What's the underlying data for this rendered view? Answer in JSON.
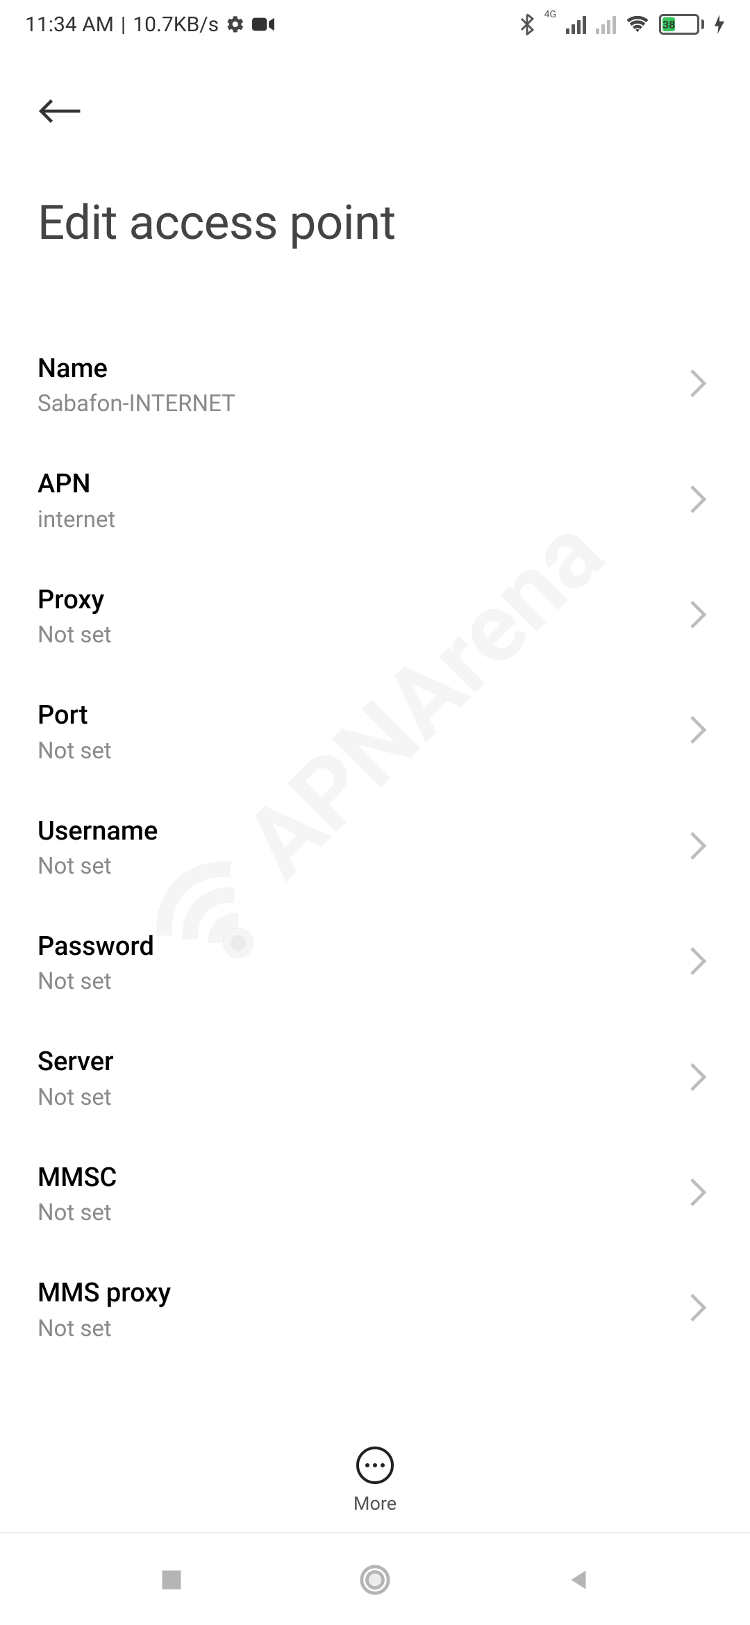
{
  "status": {
    "time": "11:34 AM",
    "speed": "10.7KB/s",
    "battery": "38"
  },
  "header": {
    "title": "Edit access point"
  },
  "settings": [
    {
      "label": "Name",
      "value": "Sabafon-INTERNET"
    },
    {
      "label": "APN",
      "value": "internet"
    },
    {
      "label": "Proxy",
      "value": "Not set"
    },
    {
      "label": "Port",
      "value": "Not set"
    },
    {
      "label": "Username",
      "value": "Not set"
    },
    {
      "label": "Password",
      "value": "Not set"
    },
    {
      "label": "Server",
      "value": "Not set"
    },
    {
      "label": "MMSC",
      "value": "Not set"
    },
    {
      "label": "MMS proxy",
      "value": "Not set"
    }
  ],
  "bottom": {
    "more": "More"
  },
  "watermark": "APNArena"
}
